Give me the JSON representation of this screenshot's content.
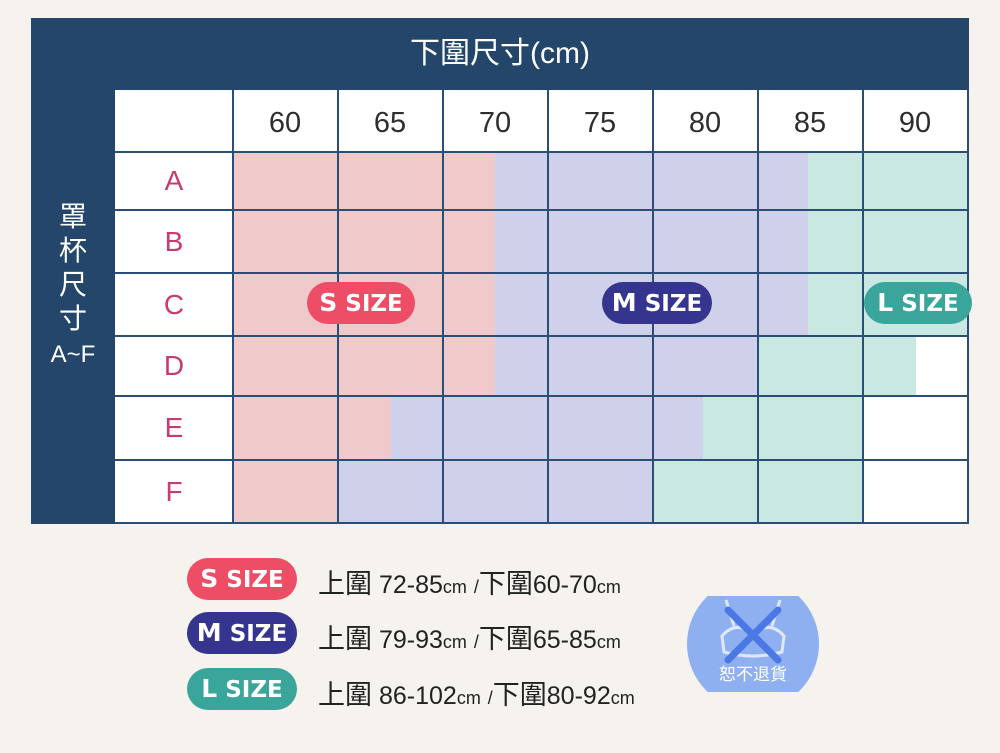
{
  "chart": {
    "title": "下圍尺寸(cm)",
    "row_title_chars": [
      "罩",
      "杯",
      "尺",
      "寸"
    ],
    "row_title_range": "A~F",
    "columns": [
      "60",
      "65",
      "70",
      "75",
      "80",
      "85",
      "90"
    ],
    "rows": [
      "A",
      "B",
      "C",
      "D",
      "E",
      "F"
    ],
    "size_zones": [
      {
        "cup": "A",
        "S": [
          "60",
          "65",
          "70"
        ],
        "M": [
          "70",
          "75",
          "80",
          "85"
        ],
        "L": [
          "85",
          "90"
        ]
      },
      {
        "cup": "B",
        "S": [
          "60",
          "65",
          "70"
        ],
        "M": [
          "70",
          "75",
          "80",
          "85"
        ],
        "L": [
          "85",
          "90"
        ]
      },
      {
        "cup": "C",
        "S": [
          "60",
          "65",
          "70"
        ],
        "M": [
          "70",
          "75",
          "80",
          "85"
        ],
        "L": [
          "85",
          "90"
        ]
      },
      {
        "cup": "D",
        "S": [
          "60",
          "65",
          "70"
        ],
        "M": [
          "70",
          "75",
          "80"
        ],
        "L": [
          "85",
          "90"
        ]
      },
      {
        "cup": "E",
        "S": [
          "60",
          "65"
        ],
        "M": [
          "65",
          "70",
          "75",
          "80"
        ],
        "L": [
          "80",
          "85"
        ]
      },
      {
        "cup": "F",
        "S": [
          "60"
        ],
        "M": [
          "65",
          "70",
          "75"
        ],
        "L": [
          "80",
          "85"
        ]
      }
    ],
    "pills": {
      "s": {
        "letter": "S",
        "word": "SIZE"
      },
      "m": {
        "letter": "M",
        "word": "SIZE"
      },
      "l": {
        "letter": "L",
        "word": "SIZE"
      }
    }
  },
  "legend": [
    {
      "letter": "S",
      "word": "SIZE",
      "upper_label": "上圍",
      "upper": "72-85",
      "unit": "cm",
      "sep": "/",
      "under_label": "下圍",
      "under": "60-70",
      "under_unit": "cm"
    },
    {
      "letter": "M",
      "word": "SIZE",
      "upper_label": "上圍",
      "upper": "79-93",
      "unit": "cm",
      "sep": "/",
      "under_label": "下圍",
      "under": "65-85",
      "under_unit": "cm"
    },
    {
      "letter": "L",
      "word": "SIZE",
      "upper_label": "上圍",
      "upper": "86-102",
      "unit": "cm",
      "sep": "/",
      "under_label": "下圍",
      "under": "80-92",
      "under_unit": "cm"
    }
  ],
  "badge": {
    "text": "恕不退貨",
    "icon": "bra-crossed-icon"
  },
  "colors": {
    "frame": "#24466b",
    "s_zone": "#f0cacb",
    "m_zone": "#cfd0ea",
    "l_zone": "#c9e8e1",
    "s_pill": "#ee4d66",
    "m_pill": "#35358f",
    "l_pill": "#3aa59a",
    "cup_label": "#c83b72",
    "badge": "#8fb0f0"
  }
}
